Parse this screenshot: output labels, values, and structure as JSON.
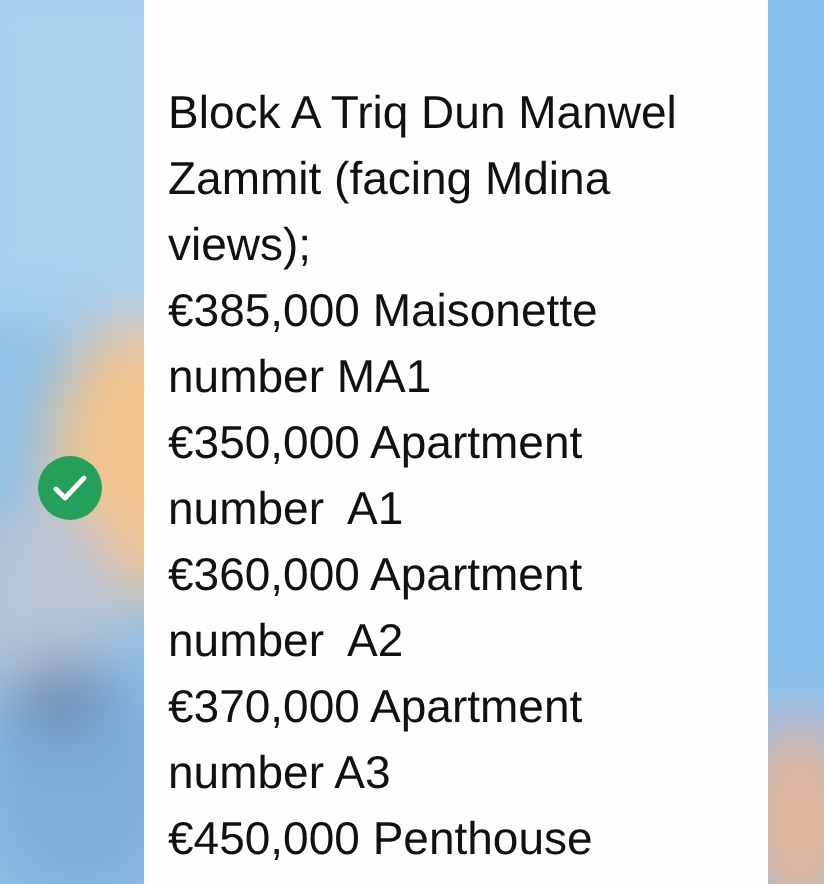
{
  "message": {
    "selected": true,
    "lines": [
      "Block A Triq Dun Manwel Zammit (facing Mdina views);",
      "€385,000 Maisonette number MA1",
      "€350,000 Apartment number  A1",
      "€360,000 Apartment number  A2",
      "€370,000 Apartment number A3",
      "€450,000 Penthouse"
    ]
  }
}
